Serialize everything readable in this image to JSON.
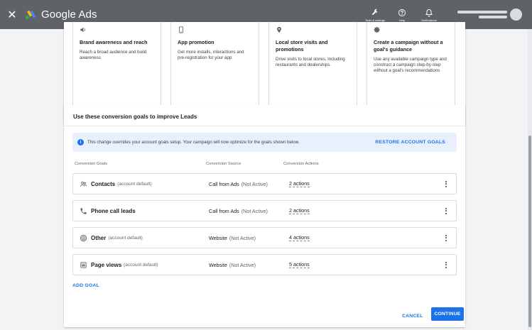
{
  "app": {
    "title": "Google Ads"
  },
  "topbar": {
    "close_glyph": "✕",
    "actions": [
      {
        "label": "Tools & settings",
        "icon": "wrench-icon"
      },
      {
        "label": "Help",
        "icon": "help-icon"
      },
      {
        "label": "Notifications",
        "icon": "bell-icon"
      }
    ]
  },
  "goal_tiles": [
    {
      "title": "Brand awareness and reach",
      "desc": "Reach a broad audience and build awareness",
      "icon": "speaker-icon"
    },
    {
      "title": "App promotion",
      "desc": "Get more installs, interactions and pre-registration for your app",
      "icon": "phone-icon"
    },
    {
      "title": "Local store visits and promotions",
      "desc": "Drive visits to local stores, including restaurants and dealerships.",
      "icon": "pin-icon"
    },
    {
      "title": "Create a campaign without a goal's guidance",
      "desc": "Use any available campaign type and construct a campaign step-by-step without a goal's recommendations",
      "icon": "gear-icon"
    }
  ],
  "conversion": {
    "section_title": "Use these conversion goals to improve Leads",
    "notice_text": "This change overrides your account goals setup. Your campaign will now optimize for the goals shown below.",
    "restore_label": "RESTORE ACCOUNT GOALS",
    "columns": [
      "Conversion Goals",
      "Conversion Source",
      "Conversion Actions"
    ],
    "rows": [
      {
        "name": "Contacts",
        "name_sub": "(account default)",
        "source": "Call from Ads",
        "source_sub": "(Not Active)",
        "actions": "2 actions",
        "icon": "contacts-icon"
      },
      {
        "name": "Phone call leads",
        "name_sub": "",
        "source": "Call from Ads",
        "source_sub": "(Not Active)",
        "actions": "2 actions",
        "icon": "phone-call-icon"
      },
      {
        "name": "Other",
        "name_sub": "(account default)",
        "source": "Website",
        "source_sub": "(Not Active)",
        "actions": "4 actions",
        "icon": "target-icon"
      },
      {
        "name": "Page views",
        "name_sub": "(account default)",
        "source": "Website",
        "source_sub": "(Not Active)",
        "actions": "5 actions",
        "icon": "page-icon"
      }
    ],
    "add_goal_label": "ADD GOAL"
  },
  "footer": {
    "cancel_label": "CANCEL",
    "continue_label": "CONTINUE"
  },
  "colors": {
    "topbar": "#5f6368",
    "accent": "#1a73e8",
    "notice_bg": "#e8f0fe"
  }
}
